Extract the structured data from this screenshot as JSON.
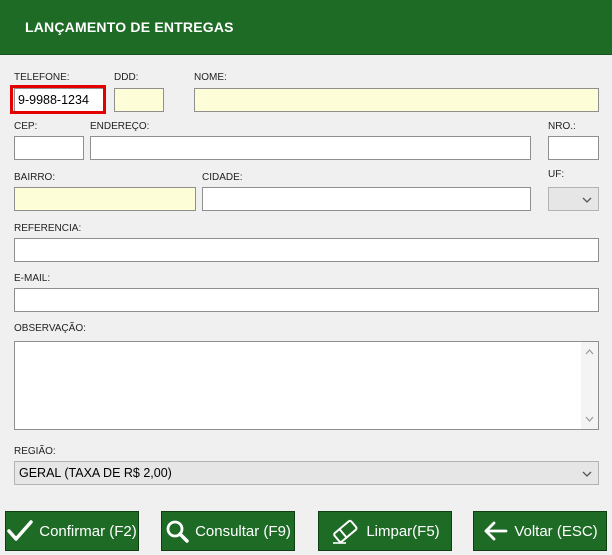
{
  "window": {
    "title": "LANÇAMENTO DE ENTREGAS"
  },
  "fields": {
    "telefone": {
      "label": "TELEFONE:",
      "value": "9-9988-1234"
    },
    "ddd": {
      "label": "DDD:",
      "value": ""
    },
    "nome": {
      "label": "NOME:",
      "value": ""
    },
    "cep": {
      "label": "CEP:",
      "value": ""
    },
    "endereco": {
      "label": "ENDEREÇO:",
      "value": ""
    },
    "nro": {
      "label": "NRO.:",
      "value": ""
    },
    "bairro": {
      "label": "BAIRRO:",
      "value": ""
    },
    "cidade": {
      "label": "CIDADE:",
      "value": ""
    },
    "uf": {
      "label": "UF:",
      "value": ""
    },
    "referencia": {
      "label": "REFERENCIA:",
      "value": ""
    },
    "email": {
      "label": "E-MAIL:",
      "value": ""
    },
    "observacao": {
      "label": "OBSERVAÇÃO:",
      "value": ""
    },
    "regiao": {
      "label": "REGIÃO:",
      "value": "GERAL (TAXA DE R$ 2,00)"
    }
  },
  "buttons": {
    "confirmar": {
      "label": "Confirmar (F2)",
      "icon": "checkmark-icon"
    },
    "consultar": {
      "label": "Consultar (F9)",
      "icon": "magnifier-icon"
    },
    "limpar": {
      "label": "Limpar(F5)",
      "icon": "eraser-icon"
    },
    "voltar": {
      "label": "Voltar (ESC)",
      "icon": "arrow-left-icon"
    }
  },
  "colors": {
    "brand_green": "#1e6b26",
    "required_field": "#fdfdd8",
    "highlight": "#e50000"
  }
}
